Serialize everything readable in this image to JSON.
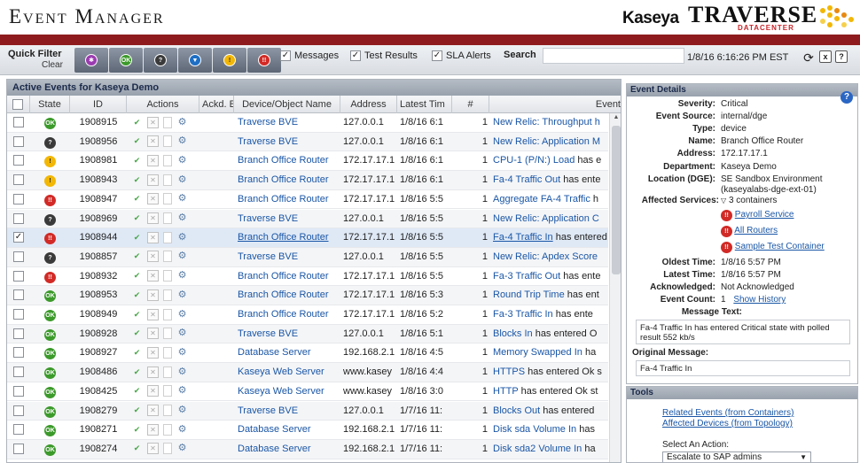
{
  "header": {
    "title": "Event Manager",
    "kaseya": "Kaseya",
    "traverse": "TRAVERSE",
    "traverse_sub": "DATACENTER"
  },
  "filterbar": {
    "quick_filter": "Quick Filter",
    "clear": "Clear",
    "buttons": [
      "pur",
      "ok",
      "unk",
      "info",
      "warn",
      "crit"
    ],
    "checks": [
      {
        "label": "Messages",
        "checked": true
      },
      {
        "label": "Test Results",
        "checked": true
      },
      {
        "label": "SLA Alerts",
        "checked": true
      }
    ],
    "search_label": "Search",
    "search_value": "",
    "clock": "1/8/16 6:16:26 PM EST"
  },
  "events": {
    "title": "Active Events for Kaseya Demo",
    "columns": [
      "State",
      "ID",
      "Actions",
      "Ackd. E",
      "Device/Object Name",
      "Address",
      "Latest Tim",
      "#",
      "Event"
    ],
    "rows": [
      {
        "check": false,
        "state": "ok",
        "id": "1908915",
        "device": "Traverse BVE",
        "address": "127.0.0.1",
        "time": "1/8/16 6:1",
        "count": "1",
        "event_link": "New Relic: Throughput h",
        "event_rest": ""
      },
      {
        "check": false,
        "state": "unk",
        "id": "1908956",
        "device": "Traverse BVE",
        "address": "127.0.0.1",
        "time": "1/8/16 6:1",
        "count": "1",
        "event_link": "New Relic: Application M",
        "event_rest": ""
      },
      {
        "check": false,
        "state": "warn",
        "id": "1908981",
        "device": "Branch Office Router",
        "address": "172.17.17.1",
        "time": "1/8/16 6:1",
        "count": "1",
        "event_link": "CPU-1 (P/N:) Load",
        "event_rest": " has e"
      },
      {
        "check": false,
        "state": "warn",
        "id": "1908943",
        "device": "Branch Office Router",
        "address": "172.17.17.1",
        "time": "1/8/16 6:1",
        "count": "1",
        "event_link": "Fa-4 Traffic Out",
        "event_rest": " has ente"
      },
      {
        "check": false,
        "state": "crit",
        "id": "1908947",
        "device": "Branch Office Router",
        "address": "172.17.17.1",
        "time": "1/8/16 5:5",
        "count": "1",
        "event_link": "Aggregate FA-4 Traffic",
        "event_rest": " h"
      },
      {
        "check": false,
        "state": "unk",
        "id": "1908969",
        "device": "Traverse BVE",
        "address": "127.0.0.1",
        "time": "1/8/16 5:5",
        "count": "1",
        "event_link": "New Relic: Application C",
        "event_rest": ""
      },
      {
        "check": true,
        "state": "crit",
        "id": "1908944",
        "device": "Branch Office Router",
        "address": "172.17.17.1",
        "time": "1/8/16 5:5",
        "count": "1",
        "event_link": "Fa-4 Traffic In",
        "event_rest": " has entered"
      },
      {
        "check": false,
        "state": "unk",
        "id": "1908857",
        "device": "Traverse BVE",
        "address": "127.0.0.1",
        "time": "1/8/16 5:5",
        "count": "1",
        "event_link": "New Relic: Apdex Score",
        "event_rest": ""
      },
      {
        "check": false,
        "state": "crit",
        "id": "1908932",
        "device": "Branch Office Router",
        "address": "172.17.17.1",
        "time": "1/8/16 5:5",
        "count": "1",
        "event_link": "Fa-3 Traffic Out",
        "event_rest": " has ente"
      },
      {
        "check": false,
        "state": "ok",
        "id": "1908953",
        "device": "Branch Office Router",
        "address": "172.17.17.1",
        "time": "1/8/16 5:3",
        "count": "1",
        "event_link": "Round Trip Time",
        "event_rest": " has ent"
      },
      {
        "check": false,
        "state": "ok",
        "id": "1908949",
        "device": "Branch Office Router",
        "address": "172.17.17.1",
        "time": "1/8/16 5:2",
        "count": "1",
        "event_link": "Fa-3 Traffic In",
        "event_rest": " has ente"
      },
      {
        "check": false,
        "state": "ok",
        "id": "1908928",
        "device": "Traverse BVE",
        "address": "127.0.0.1",
        "time": "1/8/16 5:1",
        "count": "1",
        "event_link": "Blocks In",
        "event_rest": " has entered O"
      },
      {
        "check": false,
        "state": "ok",
        "id": "1908927",
        "device": "Database Server",
        "address": "192.168.2.1",
        "time": "1/8/16 4:5",
        "count": "1",
        "event_link": "Memory Swapped In",
        "event_rest": " ha"
      },
      {
        "check": false,
        "state": "ok",
        "id": "1908486",
        "device": "Kaseya Web Server",
        "address": "www.kasey",
        "time": "1/8/16 4:4",
        "count": "1",
        "event_link": "HTTPS",
        "event_rest": " has entered Ok s"
      },
      {
        "check": false,
        "state": "ok",
        "id": "1908425",
        "device": "Kaseya Web Server",
        "address": "www.kasey",
        "time": "1/8/16 3:0",
        "count": "1",
        "event_link": "HTTP",
        "event_rest": " has entered Ok st"
      },
      {
        "check": false,
        "state": "ok",
        "id": "1908279",
        "device": "Traverse BVE",
        "address": "127.0.0.1",
        "time": "1/7/16 11:",
        "count": "1",
        "event_link": "Blocks Out",
        "event_rest": " has entered"
      },
      {
        "check": false,
        "state": "ok",
        "id": "1908271",
        "device": "Database Server",
        "address": "192.168.2.1",
        "time": "1/7/16 11:",
        "count": "1",
        "event_link": "Disk sda Volume In",
        "event_rest": " has"
      },
      {
        "check": false,
        "state": "ok",
        "id": "1908274",
        "device": "Database Server",
        "address": "192.168.2.1",
        "time": "1/7/16 11:",
        "count": "1",
        "event_link": "Disk sda2 Volume In",
        "event_rest": " ha"
      }
    ]
  },
  "details": {
    "title": "Event Details",
    "severity": {
      "label": "Severity:",
      "value": "Critical"
    },
    "source": {
      "label": "Event Source:",
      "value": "internal/dge"
    },
    "type": {
      "label": "Type:",
      "value": "device"
    },
    "name": {
      "label": "Name:",
      "value": "Branch Office Router"
    },
    "address": {
      "label": "Address:",
      "value": "172.17.17.1"
    },
    "department": {
      "label": "Department:",
      "value": "Kaseya Demo"
    },
    "location": {
      "label": "Location (DGE):",
      "value": "SE Sandbox Environment",
      "value2": "(kaseyalabs-dge-ext-01)"
    },
    "affected": {
      "label": "Affected Services:",
      "value": "3 containers",
      "services": [
        "Payroll Service",
        "All Routers",
        "Sample Test Container"
      ]
    },
    "oldest": {
      "label": "Oldest Time:",
      "value": "1/8/16 5:57 PM"
    },
    "latest": {
      "label": "Latest Time:",
      "value": "1/8/16 5:57 PM"
    },
    "ack": {
      "label": "Acknowledged:",
      "value": "Not Acknowledged"
    },
    "count": {
      "label": "Event Count:",
      "value": "1",
      "link": "Show History"
    },
    "message_label": "Message Text:",
    "message": "Fa-4 Traffic In has entered Critical state with polled result 552 kb/s",
    "original_label": "Original Message:",
    "original": "Fa-4 Traffic In"
  },
  "tools": {
    "title": "Tools",
    "related": "Related Events (from Containers)",
    "affected_devices": "Affected Devices (from Topology)",
    "select_label": "Select An Action:",
    "select_value": "Escalate to SAP admins"
  }
}
